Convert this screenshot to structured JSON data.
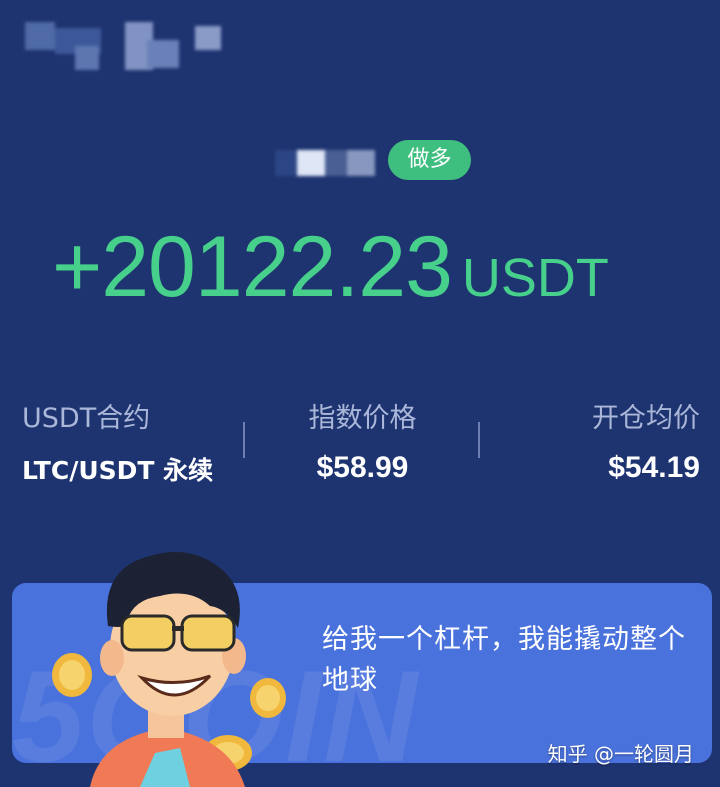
{
  "position": {
    "side_tag": "做多",
    "pnl_amount": "+20122.23",
    "pnl_unit": "USDT"
  },
  "stats": {
    "contract": {
      "label": "USDT合约",
      "value": "LTC/USDT 永续"
    },
    "index_price": {
      "label": "指数价格",
      "value": "$58.99"
    },
    "entry_price": {
      "label": "开仓均价",
      "value": "$54.19"
    }
  },
  "banner": {
    "slogan": "给我一个杠杆，我能撬动整个地球",
    "watermark": "5COIN"
  },
  "credit": "知乎 @一轮圆月",
  "colors": {
    "background": "#1e3470",
    "profit": "#46d08b",
    "tag": "#3fbf7f",
    "banner": "#4a72dc"
  },
  "icons": [
    "mascot-illustration",
    "coin-icon"
  ]
}
